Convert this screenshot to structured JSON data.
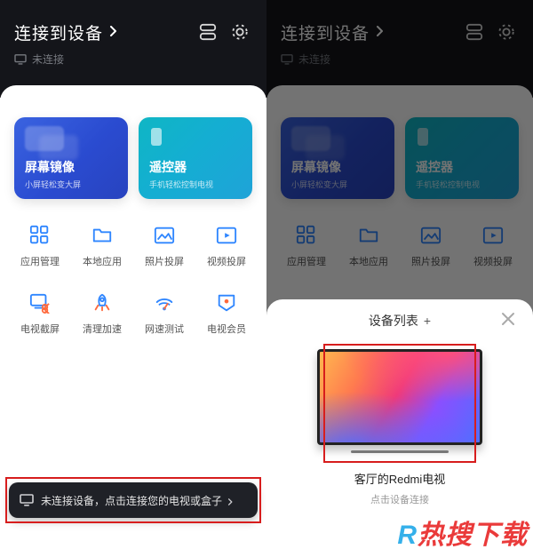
{
  "header": {
    "title": "连接到设备",
    "subtitle": "未连接"
  },
  "cards": {
    "mirror": {
      "title": "屏幕镜像",
      "sub": "小屏轻松变大屏"
    },
    "remote": {
      "title": "遥控器",
      "sub": "手机轻松控制电视"
    }
  },
  "grid": [
    {
      "key": "app-manage",
      "label": "应用管理"
    },
    {
      "key": "local-app",
      "label": "本地应用"
    },
    {
      "key": "photo-cast",
      "label": "照片投屏"
    },
    {
      "key": "video-cast",
      "label": "视频投屏"
    },
    {
      "key": "tv-screenshot",
      "label": "电视截屏"
    },
    {
      "key": "clean-boost",
      "label": "清理加速"
    },
    {
      "key": "speed-test",
      "label": "网速测试"
    },
    {
      "key": "tv-vip",
      "label": "电视会员"
    }
  ],
  "toast": {
    "text": "未连接设备，点击连接您的电视或盒子"
  },
  "deviceSheet": {
    "title": "设备列表",
    "deviceName": "客厅的Redmi电视",
    "hint": "点击设备连接"
  },
  "watermark": {
    "r": "R",
    "text": "热搜下载"
  },
  "colors": {
    "highlight": "#d71d1d"
  }
}
